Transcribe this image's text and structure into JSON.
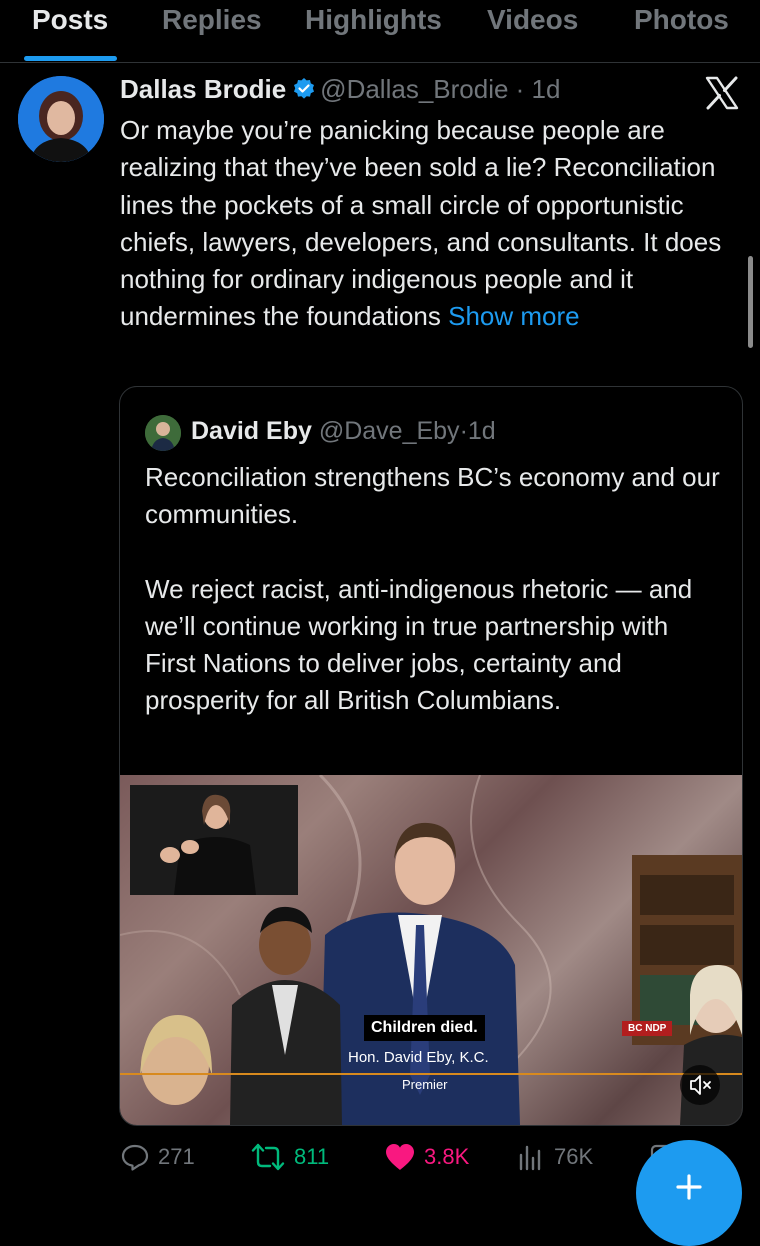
{
  "tabs": [
    {
      "label": "Posts",
      "active": true
    },
    {
      "label": "Replies",
      "active": false
    },
    {
      "label": "Highlights",
      "active": false
    },
    {
      "label": "Videos",
      "active": false
    },
    {
      "label": "Photos",
      "active": false
    }
  ],
  "post": {
    "author_name": "Dallas Brodie",
    "handle": "@Dallas_Brodie",
    "time": "1d",
    "text": "Or maybe you’re panicking because people are realizing that they’ve been sold a lie? Reconciliation lines the pockets of a small circle of opportunistic chiefs, lawyers, developers, and consultants. It does nothing for ordinary indigenous people and it undermines the foundations",
    "show_more": "Show more",
    "verified_icon": "verified-badge-icon",
    "menu_icon": "x-logo-icon"
  },
  "quote": {
    "author_name": "David Eby",
    "handle": "@Dave_Eby",
    "time": "1d",
    "paragraph_1": "Reconciliation strengthens BC’s economy and our communities.",
    "paragraph_2": "We reject racist, anti-indigenous rhetoric — and we’ll continue working in true partnership with First Nations to deliver jobs, certainty and prosperity for all British Columbians.",
    "video": {
      "caption": "Children died.",
      "lower_third_name": "Hon. David Eby, K.C.",
      "lower_third_title": "Premier",
      "party_tag": "BC NDP"
    }
  },
  "actions": {
    "replies": "271",
    "reposts": "811",
    "likes": "3.8K",
    "views": "76K"
  },
  "colors": {
    "accent": "#1d9bf0",
    "repost": "#00ba7c",
    "like": "#f91880",
    "muted": "#71767b"
  }
}
